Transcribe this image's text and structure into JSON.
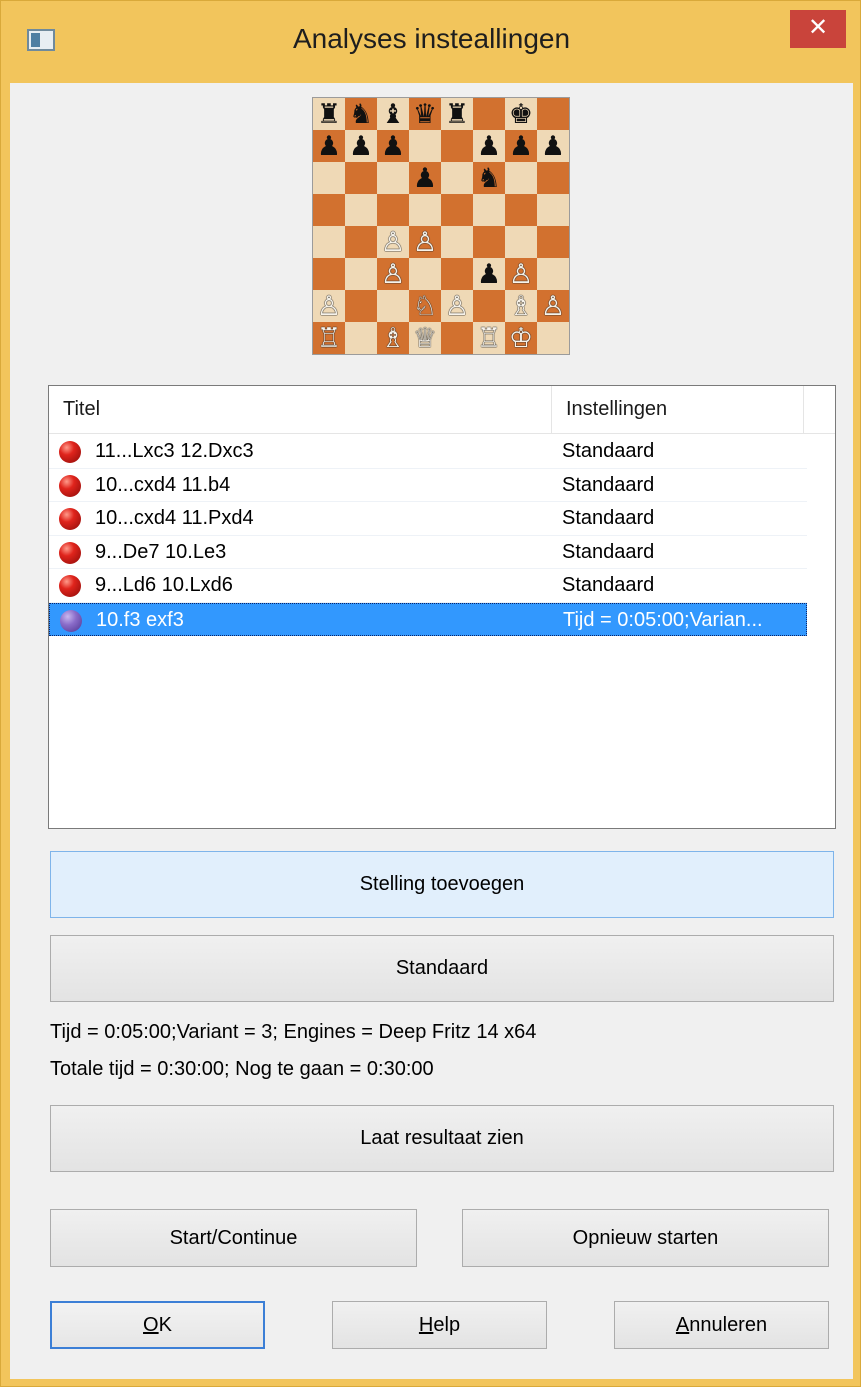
{
  "window": {
    "title": "Analyses insteallingen",
    "close_glyph": "✕"
  },
  "board": {
    "rank8": [
      "♜",
      "♞",
      "♝",
      "♛",
      "♜",
      "",
      "♚",
      ""
    ],
    "rank7": [
      "♟",
      "♟",
      "♟",
      "",
      "",
      "♟",
      "♟",
      "♟"
    ],
    "rank6": [
      "",
      "",
      "",
      "♟",
      "",
      "♞",
      "",
      ""
    ],
    "rank5": [
      "",
      "",
      "",
      "",
      "",
      "",
      "",
      ""
    ],
    "rank4": [
      "",
      "",
      "♙",
      "♙",
      "",
      "",
      "",
      ""
    ],
    "rank3": [
      "",
      "",
      "♙",
      "",
      "",
      "♟",
      "♙",
      ""
    ],
    "rank2": [
      "♙",
      "",
      "",
      "♘",
      "♙",
      "",
      "♗",
      "♙"
    ],
    "rank1": [
      "♖",
      "",
      "♗",
      "♕",
      "",
      "♖",
      "♔",
      ""
    ],
    "white_pieces": "♔♕♖♗♘♙",
    "colors": {
      "light": "#efd9b6",
      "dark": "#d2712f"
    }
  },
  "list": {
    "columns": [
      "Titel",
      "Instellingen"
    ],
    "rows": [
      {
        "title": "11...Lxc3 12.Dxc3",
        "settings": "Standaard",
        "icon": "red-ball-icon"
      },
      {
        "title": "10...cxd4 11.b4",
        "settings": "Standaard",
        "icon": "red-ball-icon"
      },
      {
        "title": "10...cxd4 11.Pxd4",
        "settings": "Standaard",
        "icon": "red-ball-icon"
      },
      {
        "title": "9...De7 10.Le3",
        "settings": "Standaard",
        "icon": "red-ball-icon"
      },
      {
        "title": "9...Ld6 10.Lxd6",
        "settings": "Standaard",
        "icon": "red-ball-icon"
      },
      {
        "title": "10.f3 exf3",
        "settings": "Tijd = 0:05:00;Varian...",
        "icon": "purple-ball-icon",
        "selected": true
      }
    ]
  },
  "buttons": {
    "add_position": "Stelling toevoegen",
    "standard": "Standaard",
    "show_result": "Laat resultaat zien",
    "start_continue": "Start/Continue",
    "restart": "Opnieuw starten",
    "ok_u": "O",
    "ok_rest": "K",
    "help_u": "H",
    "help_rest": "elp",
    "cancel_u": "A",
    "cancel_rest": "nnuleren"
  },
  "info": {
    "line1": "Tijd = 0:05:00;Variant = 3; Engines = Deep Fritz 14 x64",
    "line2": "Totale tijd = 0:30:00; Nog te gaan = 0:30:00"
  }
}
